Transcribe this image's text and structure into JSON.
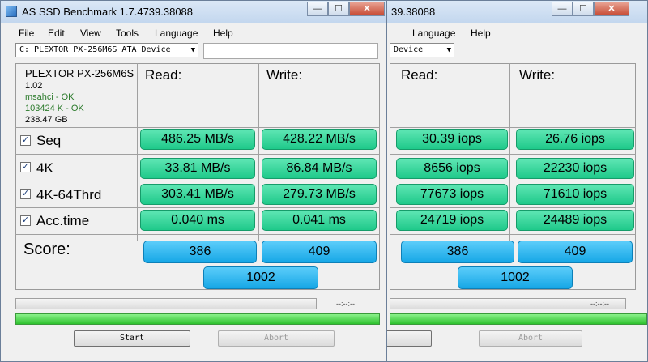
{
  "app": {
    "title": "AS SSD Benchmark 1.7.4739.38088",
    "title_partial": "39.38088"
  },
  "caption": {
    "minimize": "—",
    "maximize": "☐",
    "close": "✕"
  },
  "menu": [
    "File",
    "Edit",
    "View",
    "Tools",
    "Language",
    "Help"
  ],
  "device": {
    "selected": "C: PLEXTOR PX-256M6S ATA Device",
    "selected_partial": "Device"
  },
  "drive_info": {
    "model": "PLEXTOR PX-256M6S",
    "firmware": "1.02",
    "driver": "msahci - OK",
    "alignment": "103424 K - OK",
    "capacity": "238.47 GB"
  },
  "columns": {
    "read": "Read:",
    "write": "Write:"
  },
  "tests": [
    {
      "label": "Seq",
      "checked": true,
      "mbs_read": "486.25 MB/s",
      "mbs_write": "428.22 MB/s",
      "iops_read": "30.39 iops",
      "iops_write": "26.76 iops"
    },
    {
      "label": "4K",
      "checked": true,
      "mbs_read": "33.81 MB/s",
      "mbs_write": "86.84 MB/s",
      "iops_read": "8656 iops",
      "iops_write": "22230 iops"
    },
    {
      "label": "4K-64Thrd",
      "checked": true,
      "mbs_read": "303.41 MB/s",
      "mbs_write": "279.73 MB/s",
      "iops_read": "77673 iops",
      "iops_write": "71610 iops"
    },
    {
      "label": "Acc.time",
      "checked": true,
      "mbs_read": "0.040 ms",
      "mbs_write": "0.041 ms",
      "iops_read": "24719 iops",
      "iops_write": "24489 iops"
    }
  ],
  "score": {
    "label": "Score:",
    "read": "386",
    "write": "409",
    "total": "1002"
  },
  "progress": {
    "timer": "--:--:--",
    "test_progress": 0,
    "total_progress": 1.0
  },
  "buttons": {
    "start": "Start",
    "abort": "Abort"
  },
  "colors": {
    "result_green": "#27d192",
    "score_blue": "#1ba9e8",
    "progress_green": "#2ec22e"
  }
}
